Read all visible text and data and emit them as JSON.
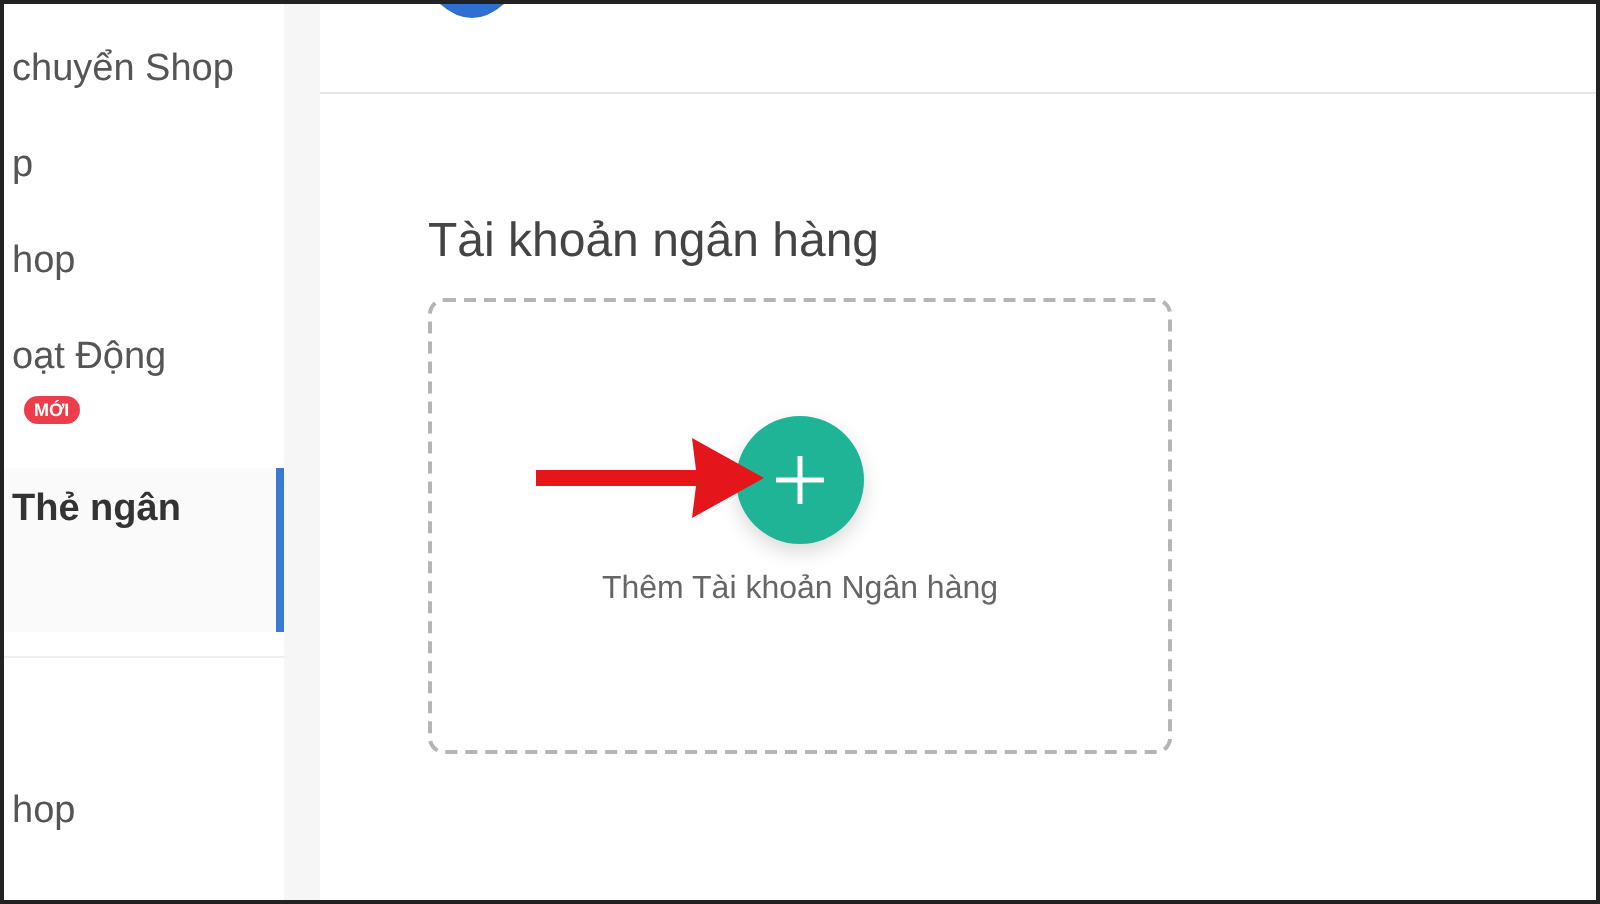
{
  "sidebar": {
    "items": [
      {
        "label": "chuyển Shop",
        "selected": false
      },
      {
        "label": "p",
        "selected": false
      },
      {
        "label": "hop",
        "selected": false
      },
      {
        "label": "oạt Động",
        "badge": "MỚI",
        "selected": false
      },
      {
        "label": "Thẻ ngân",
        "selected": true
      }
    ],
    "bottom_items": [
      {
        "label": "hop"
      }
    ]
  },
  "section": {
    "title": "Tài khoản ngân hàng",
    "add_label": "Thêm Tài khoản Ngân hàng"
  }
}
